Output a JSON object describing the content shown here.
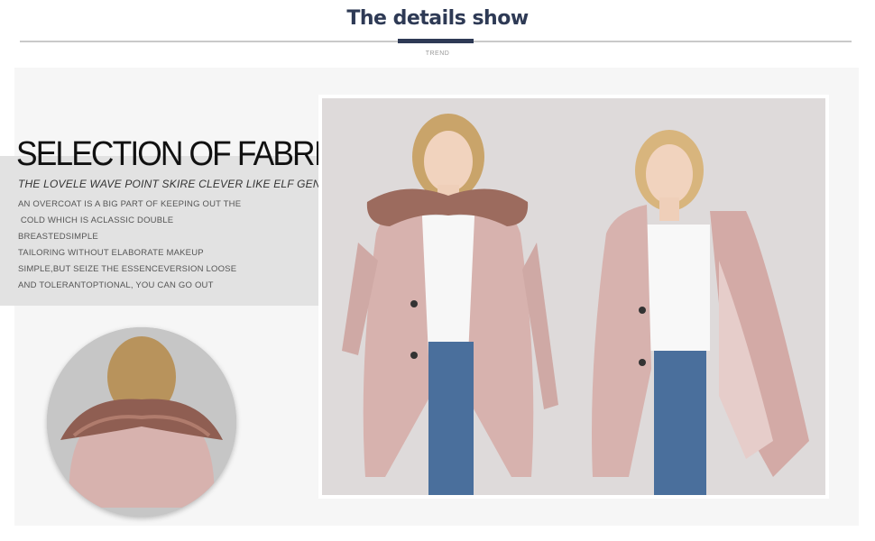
{
  "header": {
    "title": "The details show",
    "subtitle": "TREND"
  },
  "section": {
    "title": "SELECTION OF FABRICS",
    "subtitle": "THE  LOVELE WAVE POINT SKIRE CLEVER LIKE  ELF  GEN",
    "description_lines": [
      "AN OVERCOAT IS A BIG PART OF KEEPING OUT THE",
      " COLD WHICH IS ACLASSIC DOUBLE",
      "BREASTEDSIMPLE",
      "TAILORING WITHOUT ELABORATE MAKEUP",
      "SIMPLE,BUT SEIZE THE ESSENCEVERSION LOOSE",
      "AND TOLERANTOPTIONAL, YOU CAN GO OUT"
    ]
  },
  "colors": {
    "accent": "#2e3a55",
    "coat": "#d7b2ae",
    "fur": "#9c6b5e",
    "jeans": "#4a6f9c"
  }
}
